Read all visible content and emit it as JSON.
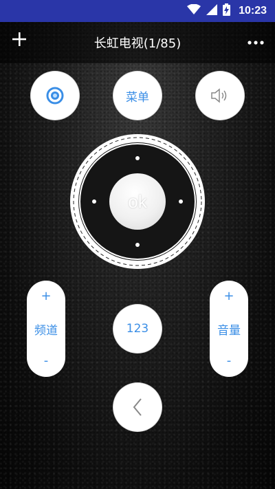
{
  "status_bar": {
    "time": "10:23",
    "bg_color": "#2a36a8"
  },
  "title_bar": {
    "title": "长虹电视(1/85)",
    "add_icon": "plus-icon",
    "more_icon": "more-dots-icon"
  },
  "buttons": {
    "power_icon": "power-icon",
    "menu_label": "菜单",
    "volume_icon": "speaker-icon",
    "ok_label": "ok",
    "number_label": "123",
    "back_icon": "chevron-left-icon"
  },
  "channel": {
    "plus": "+",
    "label": "频道",
    "minus": "-"
  },
  "volume": {
    "plus": "+",
    "label": "音量",
    "minus": "-"
  },
  "colors": {
    "accent": "#3a8ee6",
    "white": "#ffffff"
  }
}
